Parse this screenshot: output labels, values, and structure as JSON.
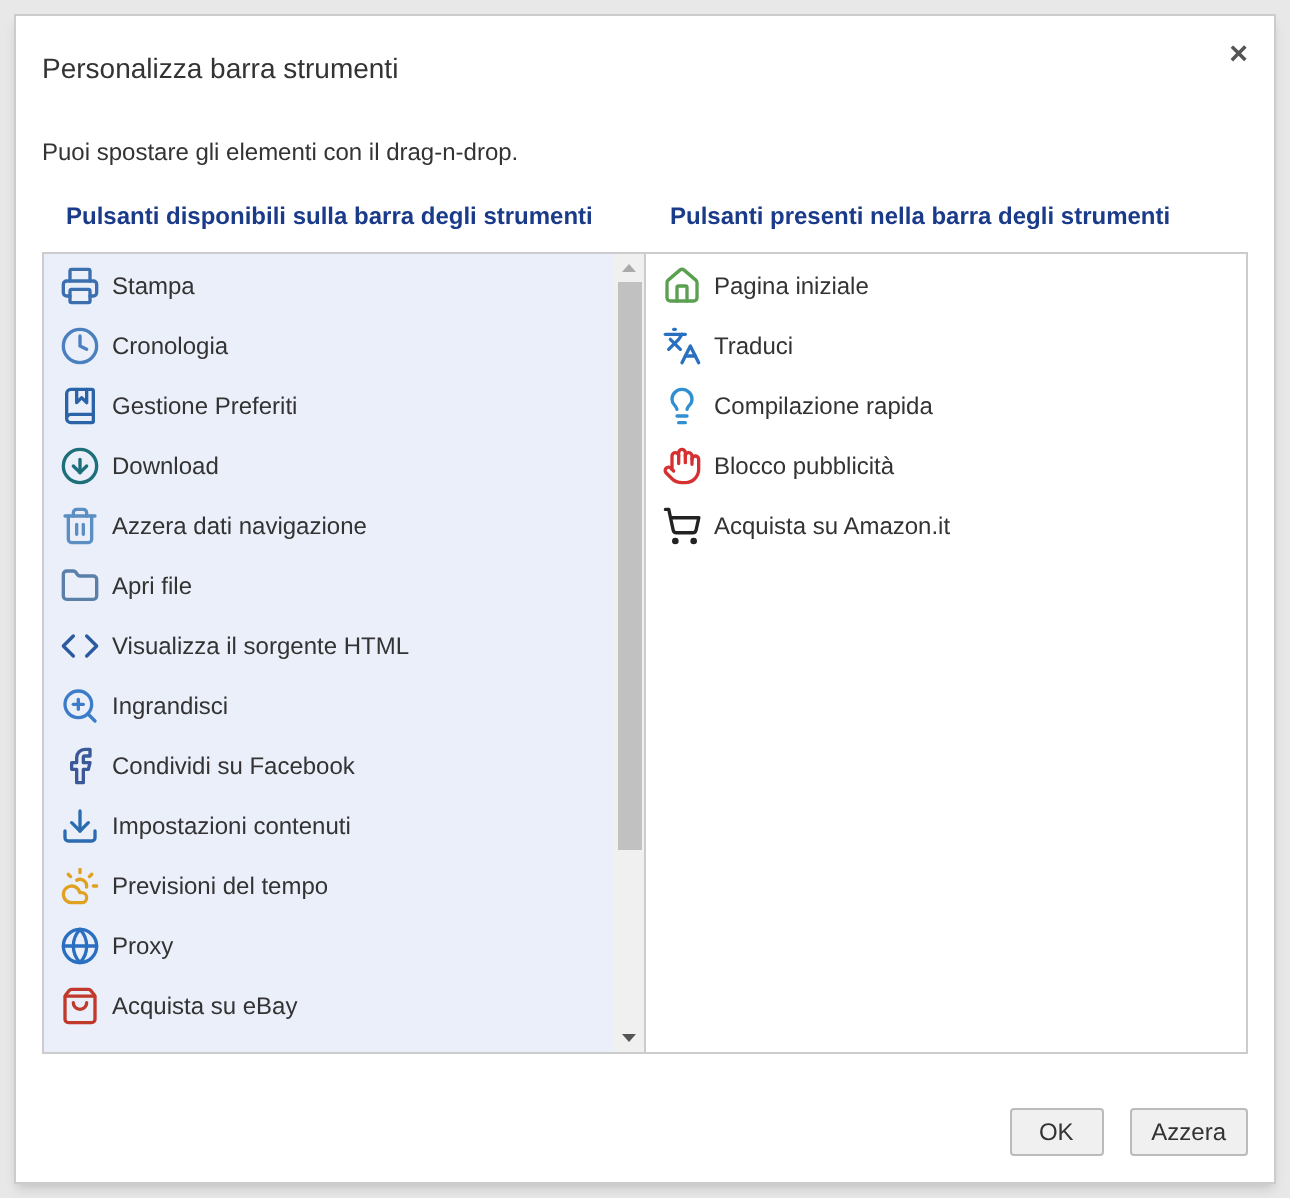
{
  "dialog": {
    "title": "Personalizza barra strumenti",
    "close": "×",
    "hint": "Puoi spostare gli elementi con il drag-n-drop."
  },
  "available": {
    "heading": "Pulsanti disponibili sulla barra degli strumenti",
    "items": [
      {
        "label": "Stampa"
      },
      {
        "label": "Cronologia"
      },
      {
        "label": "Gestione Preferiti"
      },
      {
        "label": "Download"
      },
      {
        "label": "Azzera dati navigazione"
      },
      {
        "label": "Apri file"
      },
      {
        "label": "Visualizza il sorgente HTML"
      },
      {
        "label": "Ingrandisci"
      },
      {
        "label": "Condividi su Facebook"
      },
      {
        "label": "Impostazioni contenuti"
      },
      {
        "label": "Previsioni del tempo"
      },
      {
        "label": "Proxy"
      },
      {
        "label": "Acquista su eBay"
      }
    ]
  },
  "present": {
    "heading": "Pulsanti presenti nella barra degli strumenti",
    "items": [
      {
        "label": "Pagina iniziale"
      },
      {
        "label": "Traduci"
      },
      {
        "label": "Compilazione rapida"
      },
      {
        "label": "Blocco pubblicità"
      },
      {
        "label": "Acquista su Amazon.it"
      }
    ]
  },
  "buttons": [
    "OK",
    "Azzera"
  ]
}
